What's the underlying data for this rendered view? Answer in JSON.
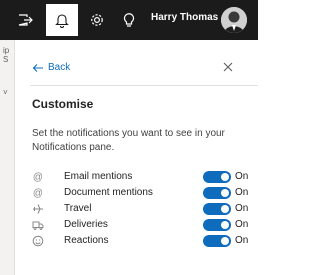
{
  "topbar": {
    "user_name": "Harry Thomas",
    "buttons": [
      {
        "icon": "sign-out-icon",
        "state": "default"
      },
      {
        "icon": "bell-icon",
        "state": "active"
      },
      {
        "icon": "gear-icon",
        "state": "default"
      },
      {
        "icon": "lightbulb-icon",
        "state": "default"
      }
    ]
  },
  "left_strip": {
    "fragments": [
      "ip",
      "S",
      "˅"
    ]
  },
  "panel": {
    "back_label": "Back",
    "title": "Customise",
    "description": "Set the notifications you want to see in your Notifications pane.",
    "items": [
      {
        "icon": "at-icon",
        "label": "Email mentions",
        "state": "On"
      },
      {
        "icon": "at-icon",
        "label": "Document mentions",
        "state": "On"
      },
      {
        "icon": "airplane-icon",
        "label": "Travel",
        "state": "On"
      },
      {
        "icon": "delivery-truck-icon",
        "label": "Deliveries",
        "state": "On"
      },
      {
        "icon": "smiley-icon",
        "label": "Reactions",
        "state": "On"
      }
    ]
  },
  "colors": {
    "topbar_bg": "#1b1b1b",
    "accent": "#0f6cbd",
    "active_tab": "#ffffff"
  }
}
